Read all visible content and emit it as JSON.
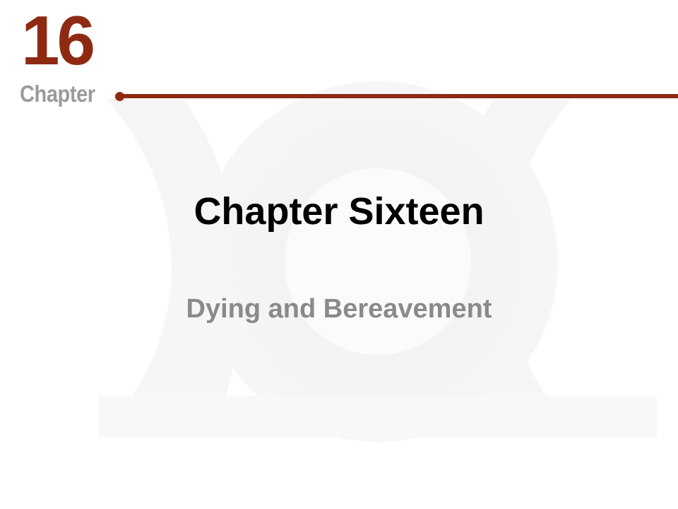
{
  "chapter_badge": {
    "number": "16",
    "word": "Chapter"
  },
  "title": "Chapter Sixteen",
  "subtitle": "Dying and Bereavement",
  "colors": {
    "accent": "#8e2a12",
    "badge_gray": "#9b9b9b",
    "title": "#000000",
    "subtitle": "#8a8a8a",
    "background": "#ffffff"
  }
}
